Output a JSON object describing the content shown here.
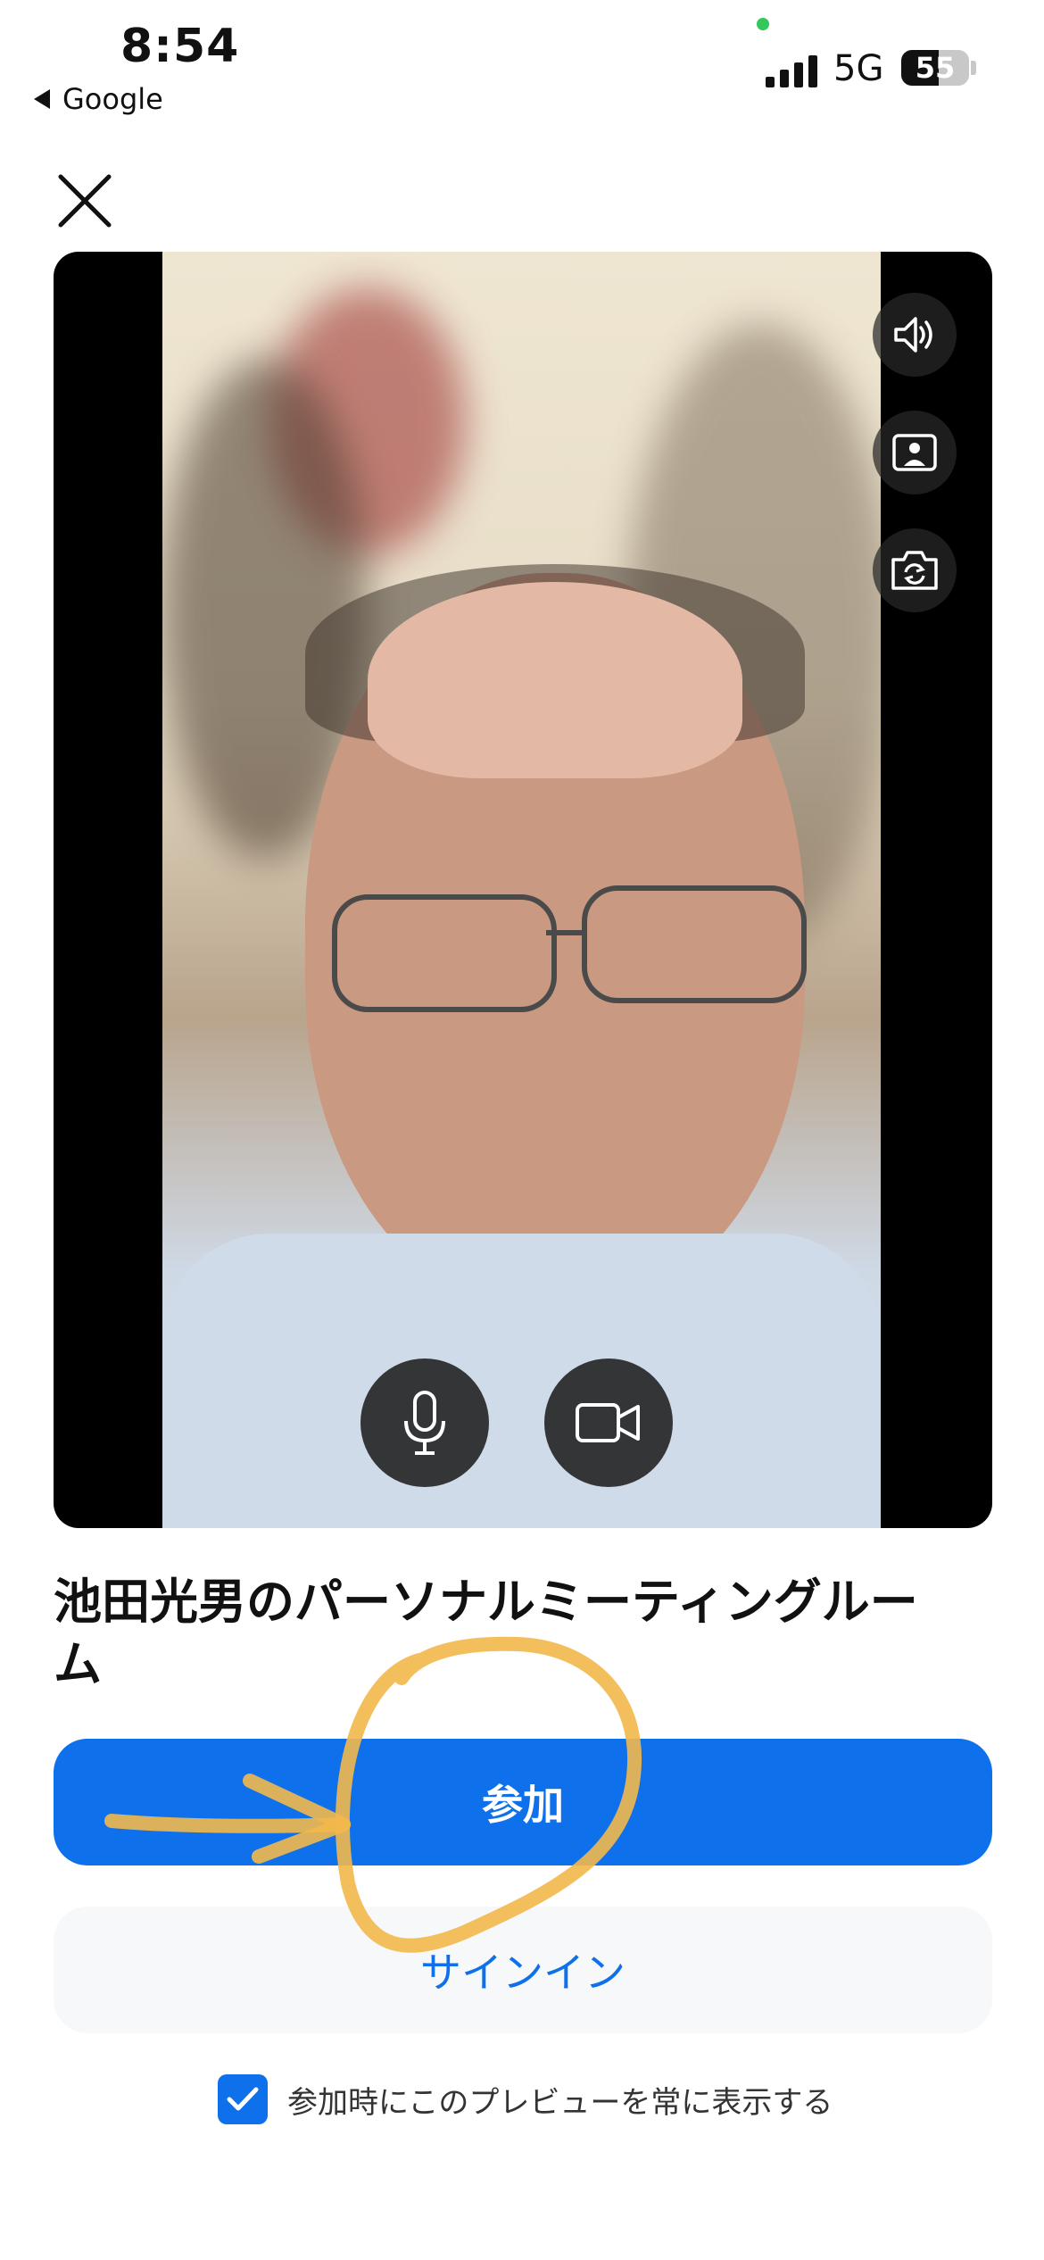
{
  "status_bar": {
    "time": "8:54",
    "back_app": "Google",
    "network": "5G",
    "battery_level": "55"
  },
  "preview": {
    "speaker_icon": "speaker-icon",
    "background_icon": "virtual-background-icon",
    "camera_switch_icon": "camera-flip-icon",
    "mic_icon": "microphone-icon",
    "video_icon": "video-camera-icon"
  },
  "meeting": {
    "title": "池田光男のパーソナルミーティングルーム"
  },
  "actions": {
    "join_label": "参加",
    "signin_label": "サインイン"
  },
  "preference": {
    "checked": true,
    "label": "参加時にこのプレビューを常に表示する"
  },
  "colors": {
    "accent": "#0e71eb",
    "annotation": "#f2b84b"
  }
}
